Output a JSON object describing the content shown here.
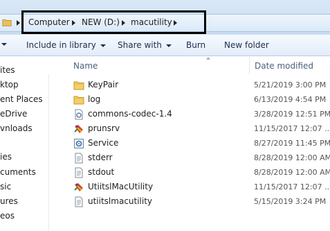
{
  "breadcrumb": [
    "Computer",
    "NEW (D:)",
    "macutility"
  ],
  "toolbar": {
    "include_in_library": "Include in library",
    "share_with": "Share with",
    "burn": "Burn",
    "new_folder": "New folder"
  },
  "nav": [
    "ites",
    "ktop",
    "ent Places",
    "eDrive",
    "vnloads",
    "ies",
    "cuments",
    "sic",
    "ures",
    "eos"
  ],
  "columns": {
    "name": "Name",
    "date": "Date modified"
  },
  "files": [
    {
      "name": "KeyPair",
      "date": "5/21/2019 3:00 PM",
      "icon": "folder-icon"
    },
    {
      "name": "log",
      "date": "6/13/2019 4:54 PM",
      "icon": "folder-icon"
    },
    {
      "name": "commons-codec-1.4",
      "date": "3/28/2019 12:51 PM",
      "icon": "settings-file-icon"
    },
    {
      "name": "prunsrv",
      "date": "11/15/2017 12:07 ...",
      "icon": "executable-icon"
    },
    {
      "name": "Service",
      "date": "8/27/2019 11:45 PM",
      "icon": "config-file-icon"
    },
    {
      "name": "stderr",
      "date": "8/28/2019 12:00 AM",
      "icon": "text-file-icon"
    },
    {
      "name": "stdout",
      "date": "8/28/2019 12:00 AM",
      "icon": "text-file-icon"
    },
    {
      "name": "UtiitslMacUtility",
      "date": "11/15/2017 12:07 ...",
      "icon": "executable-icon"
    },
    {
      "name": "utiitslmacutility",
      "date": "5/15/2019 3:24 PM",
      "icon": "text-file-icon"
    }
  ]
}
